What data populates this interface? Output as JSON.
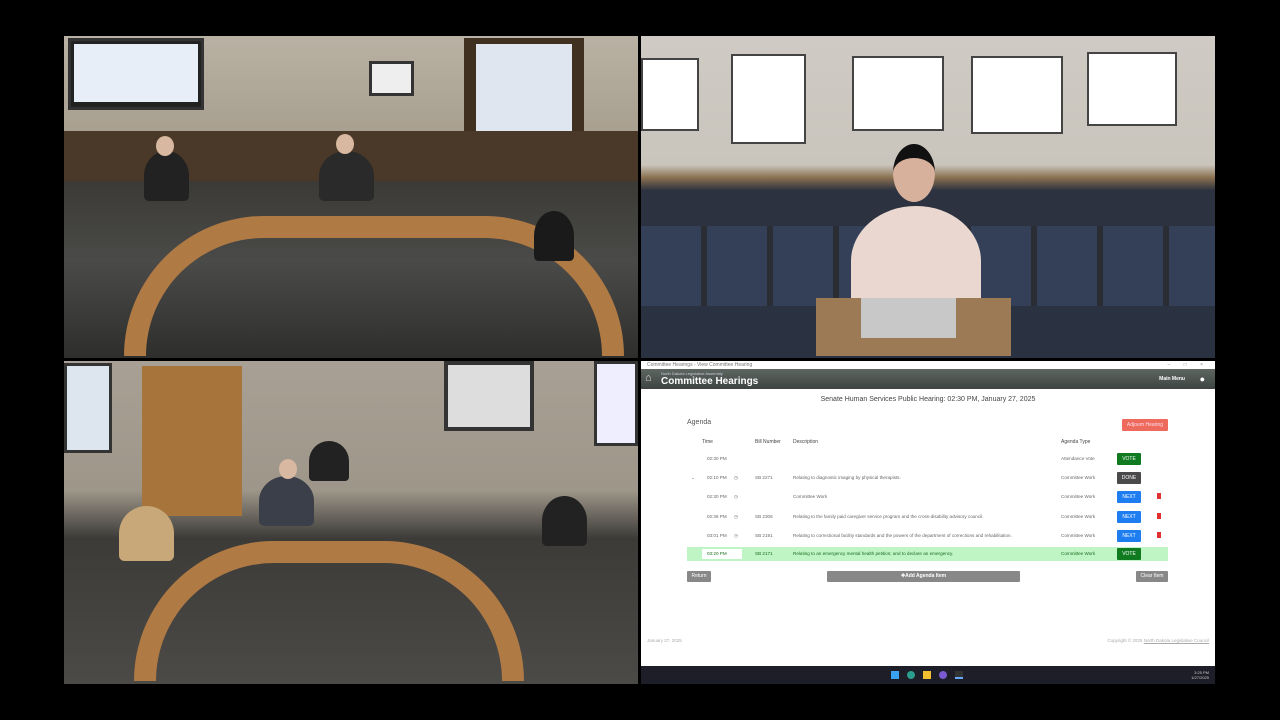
{
  "screen_share": {
    "window_title": "Committee Hearings - View Committee Hearing",
    "window_controls": "– □ ×",
    "app": {
      "org_name": "North Dakota Legislative Assembly",
      "title": "Committee Hearings",
      "main_menu": "Main Menu",
      "user_icon": "user-icon"
    },
    "hearing_title": "Senate Human Services Public Hearing: 02:30 PM, January 27, 2025",
    "agenda_label": "Agenda",
    "adjourn_label": "Adjourn Hearing",
    "columns": {
      "time": "Time",
      "bill": "Bill Number",
      "description": "Description",
      "type": "Agenda Type"
    },
    "rows": [
      {
        "time": "02:30 PM",
        "bill": "",
        "description": "",
        "type": "Attendance Vote",
        "action": "VOTE",
        "color": "#0f7a1f",
        "trash": false,
        "clock": false,
        "expand": false
      },
      {
        "time": "02:10 PM",
        "bill": "SB 2271",
        "description": "Relating to diagnostic imaging by physical therapists.",
        "type": "Committee Work",
        "action": "DONE",
        "color": "#4a4a4a",
        "trash": false,
        "clock": true,
        "expand": true
      },
      {
        "time": "02:30 PM",
        "bill": "",
        "description": "Committee Work",
        "type": "Committee Work",
        "action": "NEXT",
        "color": "#1e7ef0",
        "trash": true,
        "clock": true,
        "expand": false
      },
      {
        "time": "02:36 PM",
        "bill": "SB 2306",
        "description": "Relating to the family paid caregiver service program and the cross-disability advisory council.",
        "type": "Committee Work",
        "action": "NEXT",
        "color": "#1e7ef0",
        "trash": true,
        "clock": true,
        "expand": false
      },
      {
        "time": "03:01 PM",
        "bill": "SB 2191",
        "description": "Relating to correctional facility standards and the powers of the department of corrections and rehabilitation.",
        "type": "Committee Work",
        "action": "NEXT",
        "color": "#1e7ef0",
        "trash": true,
        "clock": true,
        "expand": false
      },
      {
        "time": "03:20 PM",
        "bill": "SB 2171",
        "description": "Relating to an emergency mental health petition; and to declare an emergency.",
        "type": "Committee Work",
        "action": "VOTE",
        "color": "#0f7a1f",
        "trash": false,
        "clock": false,
        "expand": false,
        "current": true
      }
    ],
    "return_label": "Return",
    "add_item_label": "✚Add Agenda Item",
    "clear_item_label": "Clear Item",
    "footer_date": "January 27, 2025",
    "copyright": "Copyright © 2025",
    "copyright_link": "North Dakota Legislative Council",
    "taskbar": {
      "time": "3:25 PM",
      "date": "1/27/2025"
    }
  }
}
